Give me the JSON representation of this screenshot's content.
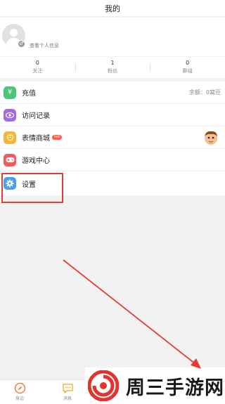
{
  "header": {
    "title": "我的"
  },
  "profile": {
    "view_profile_label": "查看个人信息",
    "gender_symbol": "♂"
  },
  "stats": [
    {
      "value": "0",
      "label": "关注"
    },
    {
      "value": "1",
      "label": "粉丝"
    },
    {
      "value": "0",
      "label": "群组"
    }
  ],
  "menu": {
    "recharge": {
      "label": "充值",
      "balance": "余额：0窝豆",
      "icon": "yen-icon"
    },
    "visits": {
      "label": "访问记录",
      "icon": "eye-icon"
    },
    "stickers": {
      "label": "表情商城",
      "badge": "hot",
      "icon": "smiley-icon"
    },
    "games": {
      "label": "游戏中心",
      "icon": "gamepad-icon"
    },
    "settings": {
      "label": "设置",
      "icon": "gear-icon"
    }
  },
  "tabbar": {
    "items": [
      {
        "label": "身边",
        "icon": "compass-icon"
      },
      {
        "label": "消息",
        "icon": "chat-icon"
      }
    ]
  },
  "watermark": {
    "text": "周三手游网"
  },
  "colors": {
    "recharge": "#4cc47a",
    "visits": "#a26ce0",
    "stickers": "#f5b53a",
    "games": "#f25b5b",
    "settings": "#4a9ff0",
    "annotation": "#e63a34"
  }
}
